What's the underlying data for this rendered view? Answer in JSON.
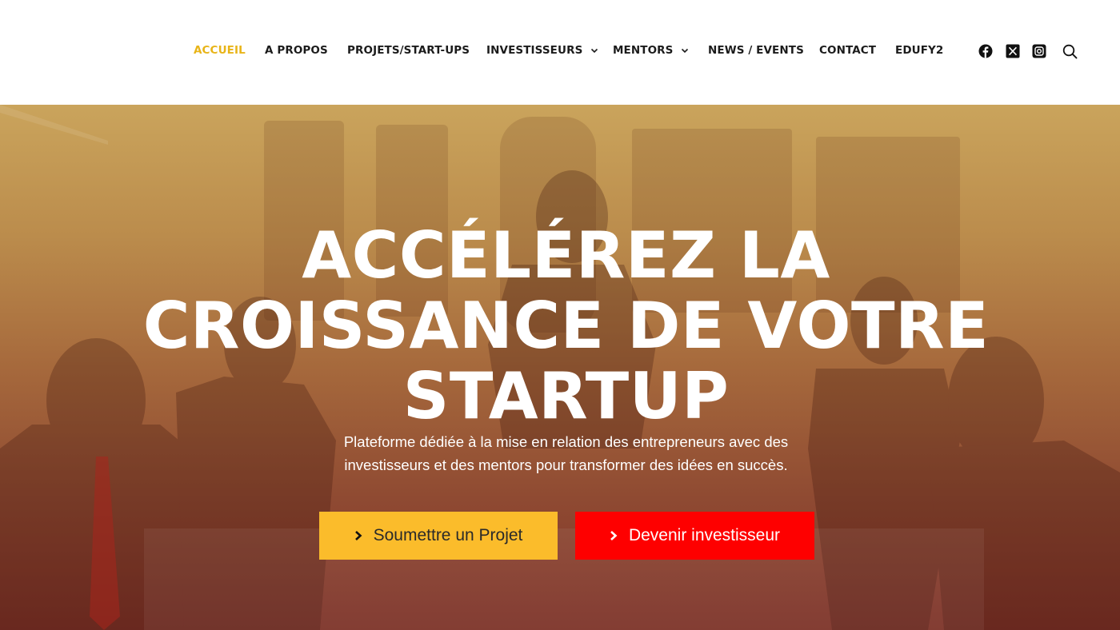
{
  "nav": {
    "items": [
      {
        "label": "ACCUEIL",
        "active": true
      },
      {
        "label": "A PROPOS"
      },
      {
        "label": "PROJETS/START-UPS"
      },
      {
        "label": "INVESTISSEURS",
        "dropdown": true
      },
      {
        "label": "MENTORS",
        "dropdown": true
      },
      {
        "label": "NEWS / EVENTS"
      },
      {
        "label": "CONTACT"
      },
      {
        "label": "EDUFY2"
      }
    ],
    "icons": [
      "facebook-icon",
      "x-twitter-icon",
      "instagram-icon",
      "search-icon"
    ]
  },
  "hero": {
    "title_lines": [
      "ACCÉLÉREZ LA",
      "CROISSANCE DE VOTRE",
      "STARTUP"
    ],
    "subtitle_line1": "Plateforme dédiée à la mise en relation des entrepreneurs avec des",
    "subtitle_line2": "investisseurs et des mentors pour transformer des idées en succès.",
    "primary_button": "Soumettre un Projet",
    "secondary_button": "Devenir investisseur"
  },
  "colors": {
    "accent": "#e8b418",
    "primary_button_bg": "#fbbc2b",
    "secondary_button_bg": "#fe0000",
    "hero_gradient_top": "#caa45c",
    "hero_gradient_bottom": "#7c3127"
  }
}
